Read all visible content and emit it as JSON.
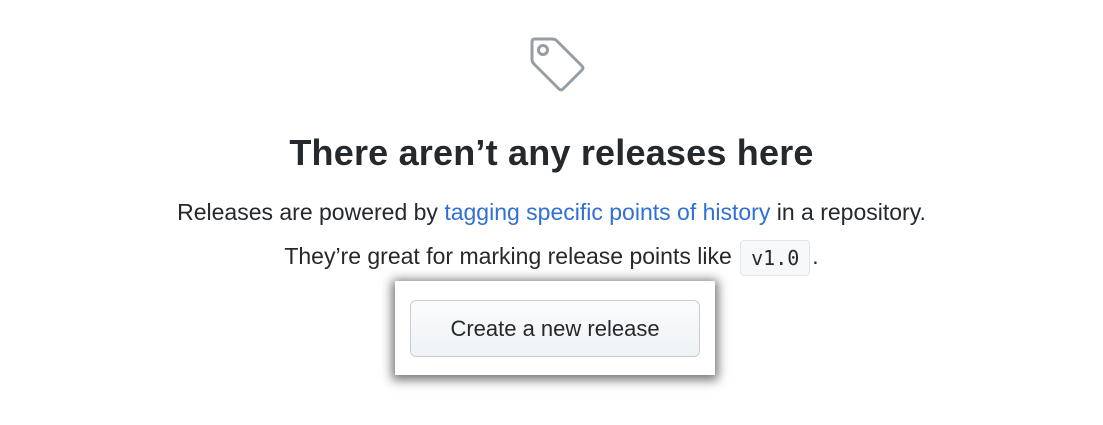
{
  "empty_state": {
    "icon": "tag-icon",
    "title": "There aren’t any releases here",
    "line1_prefix": "Releases are powered by ",
    "line1_link": "tagging specific points of history",
    "line1_suffix": " in a repository.",
    "line2_prefix": "They’re great for marking release points like ",
    "line2_code": "v1.0",
    "line2_suffix": ".",
    "button_label": "Create a new release"
  },
  "colors": {
    "link": "#2f6fd6",
    "text": "#24292e",
    "icon": "#959da5"
  }
}
